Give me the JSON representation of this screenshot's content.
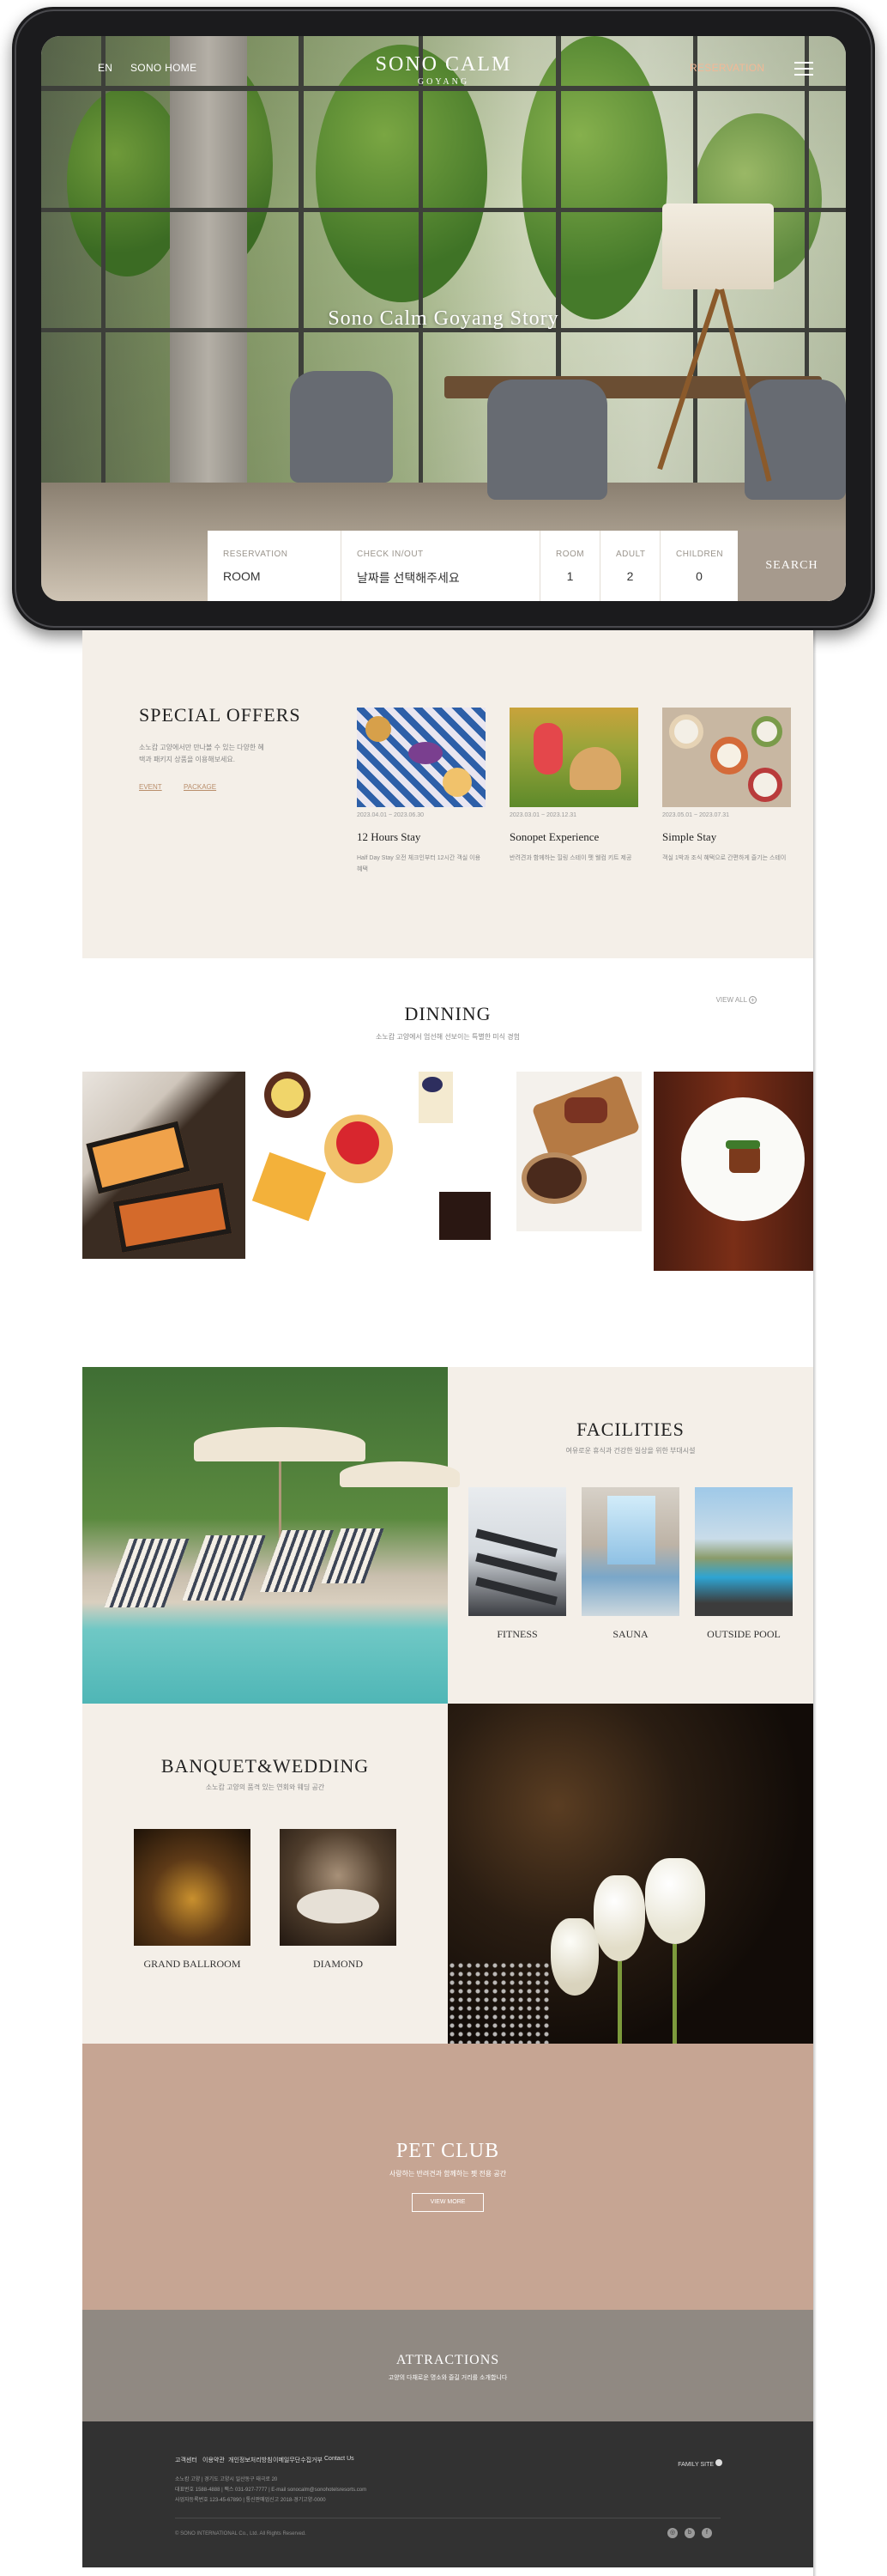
{
  "header": {
    "lang": "EN",
    "home": "SONO HOME",
    "logo_main": "SONO CALM",
    "logo_sub": "GOYANG",
    "reservation": "RESERVATION"
  },
  "hero": {
    "title": "Sono Calm Goyang Story"
  },
  "booking": {
    "reservation_label": "RESERVATION",
    "reservation_value": "ROOM",
    "checkin_label": "CHECK IN/OUT",
    "checkin_value": "날짜를 선택해주세요",
    "room_label": "ROOM",
    "room_value": "1",
    "adult_label": "ADULT",
    "adult_value": "2",
    "children_label": "CHILDREN",
    "children_value": "0",
    "search": "SEARCH"
  },
  "offers": {
    "title": "SPECIAL OFFERS",
    "desc": "소노캄 고양에서만 만나볼 수 있는 다양한 혜택과 패키지 상품을 이용해보세요.",
    "tab_event": "EVENT",
    "tab_package": "PACKAGE",
    "items": [
      {
        "date": "2023.04.01 ~ 2023.06.30",
        "title": "12 Hours Stay",
        "desc": "Half Day Stay 오전 체크인부터 12시간 객실 이용 혜택"
      },
      {
        "date": "2023.03.01 ~ 2023.12.31",
        "title": "Sonopet Experience",
        "desc": "반려견과 함께하는 힐링 스테이 펫 웰컴 키트 제공"
      },
      {
        "date": "2023.05.01 ~ 2023.07.31",
        "title": "Simple Stay",
        "desc": "객실 1박과 조식 혜택으로 간편하게 즐기는 스테이"
      }
    ]
  },
  "dinning": {
    "title": "DINNING",
    "sub": "소노캄 고양에서 엄선해 선보이는 특별한 미식 경험",
    "view_all": "VIEW ALL"
  },
  "facilities": {
    "title": "FACILITIES",
    "sub": "여유로운 휴식과 건강한 일상을 위한 부대시설",
    "items": [
      "FITNESS",
      "SAUNA",
      "OUTSIDE POOL"
    ]
  },
  "banquet": {
    "title": "BANQUET&WEDDING",
    "sub": "소노캄 고양의 품격 있는 연회와 웨딩 공간",
    "items": [
      "GRAND BALLROOM",
      "DIAMOND"
    ]
  },
  "petclub": {
    "title": "PET CLUB",
    "sub": "사랑하는 반려견과 함께하는 펫 전용 공간",
    "button": "VIEW MORE"
  },
  "attractions": {
    "title": "ATTRACTIONS",
    "sub": "고양의 다채로운 명소와 즐길 거리를 소개합니다"
  },
  "footer": {
    "links": [
      "고객센터",
      "이용약관",
      "개인정보처리방침",
      "이메일무단수집거부",
      "Contact Us"
    ],
    "info1": "소노캄 고양 | 경기도 고양시 일산동구 태극로 20",
    "info2": "대표번호 1588-4888 | 팩스 031-927-7777 | E-mail sonocalm@sonohotelsresorts.com",
    "info3": "사업자등록번호 123-45-67890 | 통신판매업신고 2018-경기고양-0000",
    "family_site": "FAMILY SITE",
    "copyright": "© SONO INTERNATIONAL Co., Ltd. All Rights Reserved."
  },
  "colors": {
    "beige_bg": "#f4efe8",
    "pet_club": "#c6a593",
    "attractions": "#908982",
    "footer": "#323232",
    "search_btn": "#a69a8d"
  }
}
